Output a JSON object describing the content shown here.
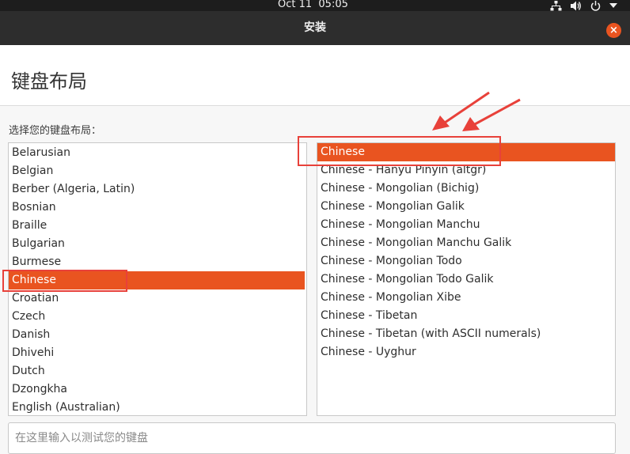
{
  "topbar": {
    "clock": "Oct 11  05:05",
    "icons": [
      "network-icon",
      "volume-icon",
      "power-icon",
      "chevron-down-icon"
    ]
  },
  "window": {
    "title": "安装",
    "close_glyph": "×"
  },
  "page": {
    "title": "键盘布局",
    "choose_label": "选择您的键盘布局："
  },
  "layouts": [
    "Belarusian",
    "Belgian",
    "Berber (Algeria, Latin)",
    "Bosnian",
    "Braille",
    "Bulgarian",
    "Burmese",
    "Chinese",
    "Croatian",
    "Czech",
    "Danish",
    "Dhivehi",
    "Dutch",
    "Dzongkha",
    "English (Australian)"
  ],
  "selected_layout": "Chinese",
  "variants": [
    "Chinese",
    "Chinese - Hanyu Pinyin (altgr)",
    "Chinese - Mongolian (Bichig)",
    "Chinese - Mongolian Galik",
    "Chinese - Mongolian Manchu",
    "Chinese - Mongolian Manchu Galik",
    "Chinese - Mongolian Todo",
    "Chinese - Mongolian Todo Galik",
    "Chinese - Mongolian Xibe",
    "Chinese - Tibetan",
    "Chinese - Tibetan (with ASCII numerals)",
    "Chinese - Uyghur"
  ],
  "selected_variant": "Chinese",
  "test_input": {
    "value": "",
    "placeholder": "在这里输入以测试您的键盘"
  },
  "colors": {
    "accent": "#e95420",
    "annotation": "#e8413a"
  }
}
